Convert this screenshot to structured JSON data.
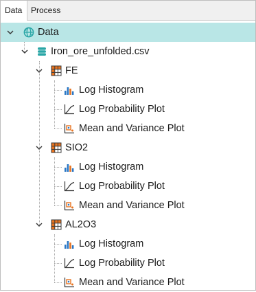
{
  "tabs": {
    "data": "Data",
    "process": "Process"
  },
  "tree": {
    "root": {
      "label": "Data",
      "icon": "globe-data-icon"
    },
    "file": {
      "label": "Iron_ore_unfolded.csv",
      "icon": "database-icon"
    },
    "variables": [
      {
        "label": "FE",
        "icon": "table-grid-icon",
        "children": [
          {
            "label": "Log Histogram",
            "icon": "histogram-icon"
          },
          {
            "label": "Log Probability Plot",
            "icon": "probability-plot-icon"
          },
          {
            "label": "Mean and Variance Plot",
            "icon": "mean-variance-plot-icon"
          }
        ]
      },
      {
        "label": "SIO2",
        "icon": "table-grid-icon",
        "children": [
          {
            "label": "Log Histogram",
            "icon": "histogram-icon"
          },
          {
            "label": "Log Probability Plot",
            "icon": "probability-plot-icon"
          },
          {
            "label": "Mean and Variance Plot",
            "icon": "mean-variance-plot-icon"
          }
        ]
      },
      {
        "label": "AL2O3",
        "icon": "table-grid-icon",
        "children": [
          {
            "label": "Log Histogram",
            "icon": "histogram-icon"
          },
          {
            "label": "Log Probability Plot",
            "icon": "probability-plot-icon"
          },
          {
            "label": "Mean and Variance Plot",
            "icon": "mean-variance-plot-icon"
          }
        ]
      }
    ]
  },
  "colors": {
    "selected_row": "#b9e6e6",
    "globe": "#2aa6a6",
    "database": "#2aa6a6",
    "grid_orange": "#e8731f",
    "histogram_blue": "#2b78c5",
    "histogram_orange": "#e8731f"
  }
}
